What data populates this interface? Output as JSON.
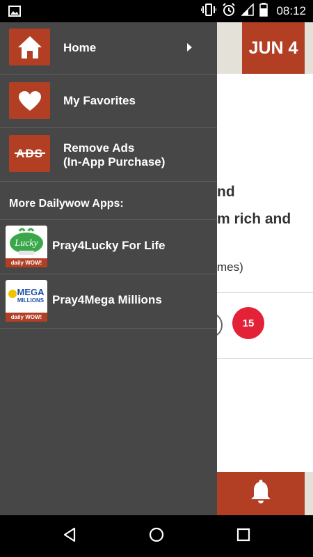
{
  "status_bar": {
    "time": "08:12",
    "icons": [
      "image-icon",
      "vibrate-icon",
      "alarm-icon",
      "signal-icon",
      "battery-icon"
    ]
  },
  "background": {
    "date_badge": "JUN 4",
    "text_line1": "nd",
    "text_line2": "m rich and",
    "text_line3": "mes)",
    "ball_number": "15",
    "accent_color": "#b23f24",
    "ball_color": "#e32238"
  },
  "drawer": {
    "items": [
      {
        "label": "Home",
        "icon": "home-icon"
      },
      {
        "label": "My Favorites",
        "icon": "heart-icon"
      },
      {
        "label_line1": "Remove Ads",
        "label_line2": "(In-App Purchase)",
        "icon": "remove-ads-icon",
        "icon_text": "ADS"
      }
    ],
    "section_header": "More Dailywow Apps:",
    "apps": [
      {
        "label": "Pray4Lucky For Life",
        "icon": "lucky-for-life-logo",
        "logo_text": "Lucky",
        "strip_text": "daily WOW!"
      },
      {
        "label": "Pray4Mega Millions",
        "icon": "mega-millions-logo",
        "logo_text_1": "MEGA",
        "logo_text_2": "MILLIONS",
        "strip_text": "daily WOW!"
      }
    ]
  },
  "nav_bar": {
    "buttons": [
      "back-icon",
      "home-circle-icon",
      "recents-icon"
    ]
  }
}
